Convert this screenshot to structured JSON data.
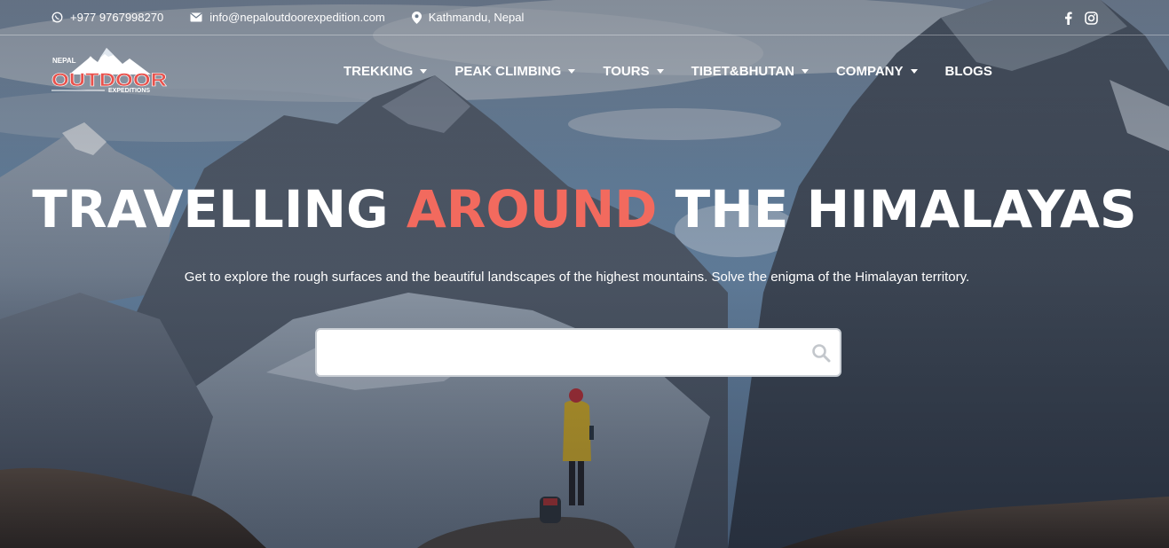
{
  "topbar": {
    "phone": "+977 9767998270",
    "email": "info@nepaloutdoorexpedition.com",
    "location": "Kathmandu, Nepal",
    "social": [
      "facebook-icon",
      "instagram-icon"
    ]
  },
  "logo": {
    "line1": "NEPAL",
    "line2": "OUTDOOR",
    "line3": "EXPEDITIONS"
  },
  "nav": {
    "items": [
      {
        "label": "TREKKING",
        "dropdown": true
      },
      {
        "label": "PEAK CLIMBING",
        "dropdown": true
      },
      {
        "label": "TOURS",
        "dropdown": true
      },
      {
        "label": "TIBET&BHUTAN",
        "dropdown": true
      },
      {
        "label": "COMPANY",
        "dropdown": true
      },
      {
        "label": "BLOGS",
        "dropdown": false
      }
    ]
  },
  "hero": {
    "title_part1": "TRAVELLING ",
    "title_accent": "AROUND",
    "title_part2": " THE HIMALAYAS",
    "subtitle": "Get to explore the rough surfaces and the beautiful landscapes of the highest mountains. Solve the enigma of the Himalayan territory."
  },
  "search": {
    "value": "",
    "placeholder": "",
    "icon": "search-icon"
  },
  "colors": {
    "accent": "#f26a5e",
    "text": "#ffffff"
  }
}
